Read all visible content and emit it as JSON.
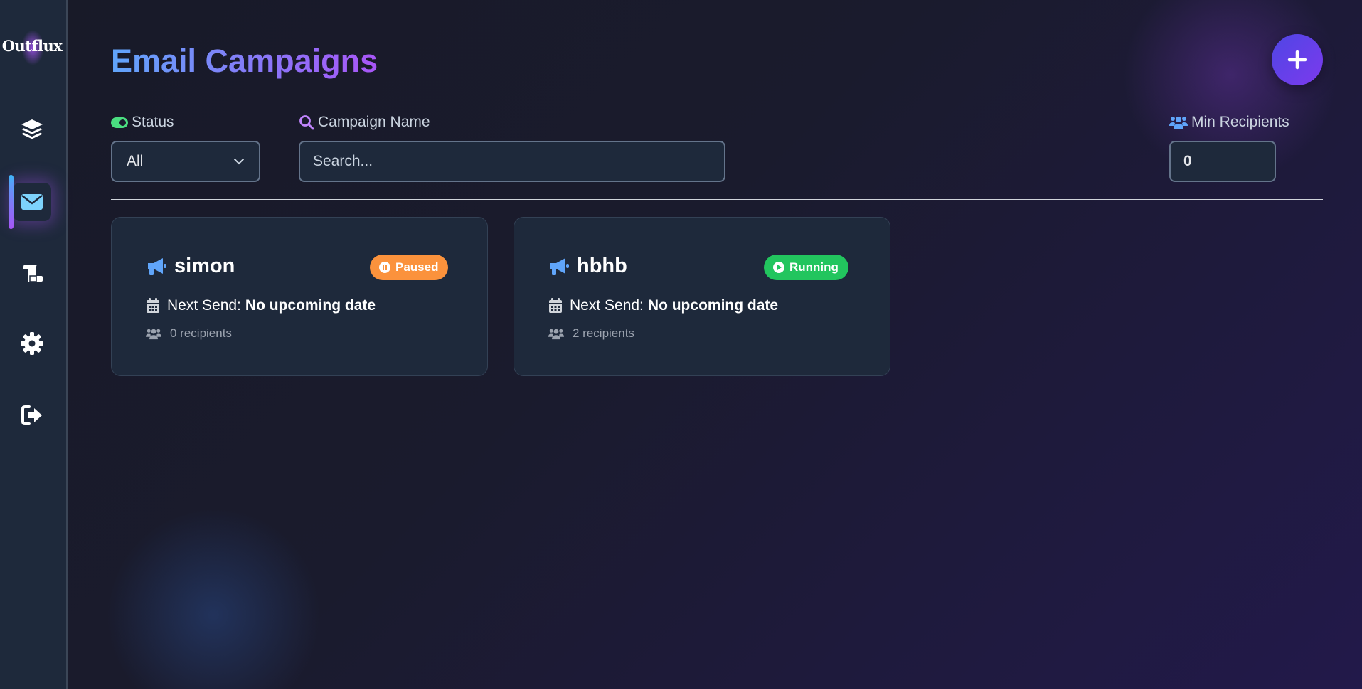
{
  "app": {
    "logo_text": "Outflux"
  },
  "sidebar": {
    "items": [
      {
        "name": "dashboard",
        "icon": "layers-icon",
        "active": false
      },
      {
        "name": "campaigns",
        "icon": "envelope-icon",
        "active": true
      },
      {
        "name": "templates",
        "icon": "scroll-icon",
        "active": false
      },
      {
        "name": "settings",
        "icon": "gear-icon",
        "active": false
      },
      {
        "name": "logout",
        "icon": "sign-out-icon",
        "active": false
      }
    ]
  },
  "header": {
    "title": "Email Campaigns",
    "add_icon": "plus-icon"
  },
  "filters": {
    "status": {
      "label": "Status",
      "icon": "toggle-icon",
      "selected": "All"
    },
    "campaign_name": {
      "label": "Campaign Name",
      "icon": "search-icon",
      "value": "",
      "placeholder": "Search..."
    },
    "min_recipients": {
      "label": "Min Recipients",
      "icon": "users-icon",
      "value": "0"
    }
  },
  "campaigns": [
    {
      "name": "simon",
      "status": "Paused",
      "status_color": "#fb923c",
      "next_send_label": "Next Send:",
      "next_send_value": "No upcoming date",
      "recipients": "0 recipients"
    },
    {
      "name": "hbhb",
      "status": "Running",
      "status_color": "#22c55e",
      "next_send_label": "Next Send:",
      "next_send_value": "No upcoming date",
      "recipients": "2 recipients"
    }
  ],
  "colors": {
    "accent_blue": "#60a5fa",
    "accent_purple": "#a855f7",
    "card_bg": "#1e293b"
  }
}
